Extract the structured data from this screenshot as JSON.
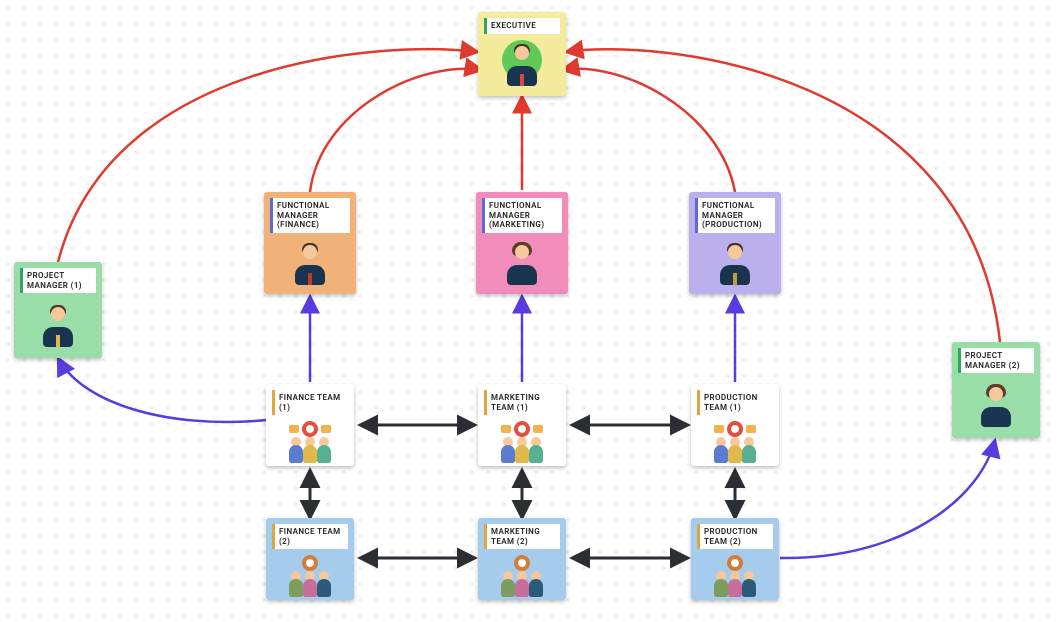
{
  "diagram_type": "matrix_org_chart",
  "colors": {
    "edge_report": "#e03a2f",
    "edge_functional": "#5a3be0",
    "edge_coordination": "#2b2e33",
    "node_executive": "#f5eb9d",
    "node_pm": "#99dda8",
    "node_fm_finance": "#f1b27a",
    "node_fm_marketing": "#f28dbb",
    "node_fm_production": "#bcb0ec",
    "node_team_row1": "#ffffff",
    "node_team_row2": "#a5cbed"
  },
  "nodes": {
    "executive": {
      "label": "EXECUTIVE",
      "icon": "executive-person-icon"
    },
    "pm1": {
      "label": "PROJECT MANAGER (1)",
      "icon": "manager-person-icon"
    },
    "pm2": {
      "label": "PROJECT MANAGER (2)",
      "icon": "manager-person-female-icon"
    },
    "fm_finance": {
      "label": "FUNCTIONAL MANAGER (FINANCE)",
      "icon": "manager-person-icon"
    },
    "fm_marketing": {
      "label": "FUNCTIONAL MANAGER (MARKETING)",
      "icon": "manager-person-female-icon"
    },
    "fm_production": {
      "label": "FUNCTIONAL MANAGER (PRODUCTION)",
      "icon": "manager-person-icon"
    },
    "finance_team_1": {
      "label": "FINANCE TEAM (1)",
      "icon": "team-group-icon"
    },
    "marketing_team_1": {
      "label": "MARKETING TEAM (1)",
      "icon": "team-group-icon"
    },
    "production_team_1": {
      "label": "PRODUCTION TEAM (1)",
      "icon": "team-group-icon"
    },
    "finance_team_2": {
      "label": "FINANCE TEAM (2)",
      "icon": "team-group-alt-icon"
    },
    "marketing_team_2": {
      "label": "MARKETING TEAM (2)",
      "icon": "team-group-alt-icon"
    },
    "production_team_2": {
      "label": "PRODUCTION TEAM (2)",
      "icon": "team-group-alt-icon"
    }
  },
  "edges": [
    {
      "from": "pm1",
      "to": "executive",
      "style": "report"
    },
    {
      "from": "fm_finance",
      "to": "executive",
      "style": "report"
    },
    {
      "from": "fm_marketing",
      "to": "executive",
      "style": "report"
    },
    {
      "from": "fm_production",
      "to": "executive",
      "style": "report"
    },
    {
      "from": "pm2",
      "to": "executive",
      "style": "report"
    },
    {
      "from": "finance_team_1",
      "to": "fm_finance",
      "style": "functional"
    },
    {
      "from": "marketing_team_1",
      "to": "fm_marketing",
      "style": "functional"
    },
    {
      "from": "production_team_1",
      "to": "fm_production",
      "style": "functional"
    },
    {
      "from": "finance_team_1",
      "to": "pm1",
      "style": "functional"
    },
    {
      "from": "production_team_2",
      "to": "pm2",
      "style": "functional"
    },
    {
      "from": "finance_team_1",
      "to": "finance_team_2",
      "style": "coordination_bidir"
    },
    {
      "from": "marketing_team_1",
      "to": "marketing_team_2",
      "style": "coordination_bidir"
    },
    {
      "from": "production_team_1",
      "to": "production_team_2",
      "style": "coordination_bidir"
    },
    {
      "from": "finance_team_1",
      "to": "marketing_team_1",
      "style": "coordination_bidir"
    },
    {
      "from": "marketing_team_1",
      "to": "production_team_1",
      "style": "coordination_bidir"
    },
    {
      "from": "finance_team_2",
      "to": "marketing_team_2",
      "style": "coordination_bidir"
    },
    {
      "from": "marketing_team_2",
      "to": "production_team_2",
      "style": "coordination_bidir"
    }
  ]
}
